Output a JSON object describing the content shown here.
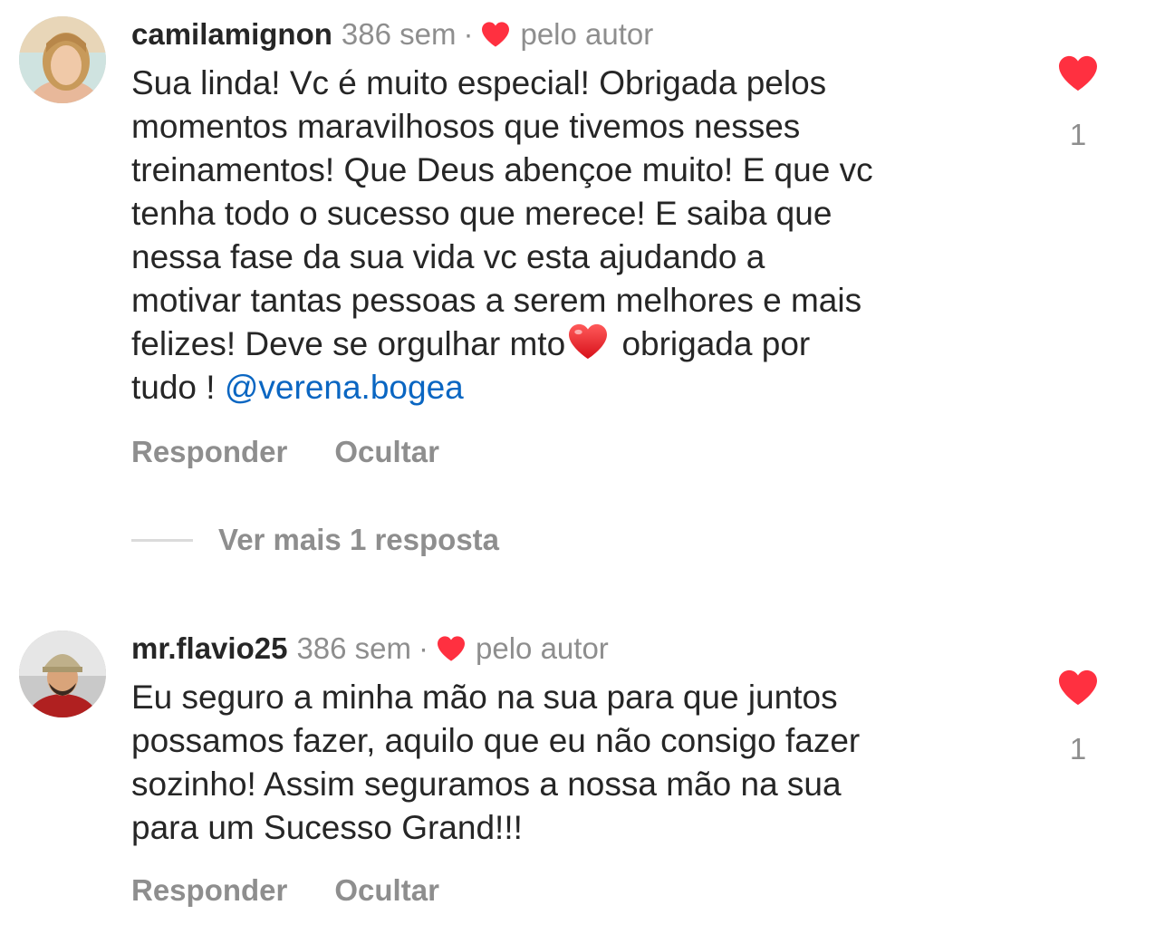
{
  "comments": [
    {
      "username": "camilamignon",
      "time": "386 sem",
      "separator": "·",
      "byauthor_label": "pelo autor",
      "text_lines": [
        "Sua linda! Vc é muito especial! Obrigada pelos",
        "momentos maravilhosos que tivemos nesses",
        "treinamentos! Que Deus abençoe muito! E que vc",
        "tenha todo o sucesso que merece! E saiba que",
        "nessa fase da sua vida vc esta ajudando a",
        "motivar tantas pessoas a serem melhores e mais"
      ],
      "line7_before_heart": "felizes! Deve se orgulhar mto",
      "line7_after_heart": " obrigada por",
      "line8_text": "tudo ! ",
      "mention": "@verena.bogea",
      "reply_label": "Responder",
      "hide_label": "Ocultar",
      "like_count": "1"
    },
    {
      "username": "mr.flavio25",
      "time": "386 sem",
      "separator": "·",
      "byauthor_label": "pelo autor",
      "text_lines": [
        "Eu seguro a minha mão na sua para que juntos",
        "possamos fazer, aquilo que eu não consigo fazer",
        "sozinho!  Assim seguramos a nossa mão na sua",
        "para um Sucesso Grand!!!"
      ],
      "reply_label": "Responder",
      "hide_label": "Ocultar",
      "like_count": "1"
    }
  ],
  "view_replies_label": "Ver mais 1 resposta",
  "colors": {
    "heart": "#ff3040",
    "muted": "#8e8e8e",
    "text": "#262626",
    "mention": "#0a66c2"
  },
  "icons": {
    "byauthor": "heart-icon",
    "like": "heart-icon",
    "inline_emoji": "red-heart-emoji"
  }
}
